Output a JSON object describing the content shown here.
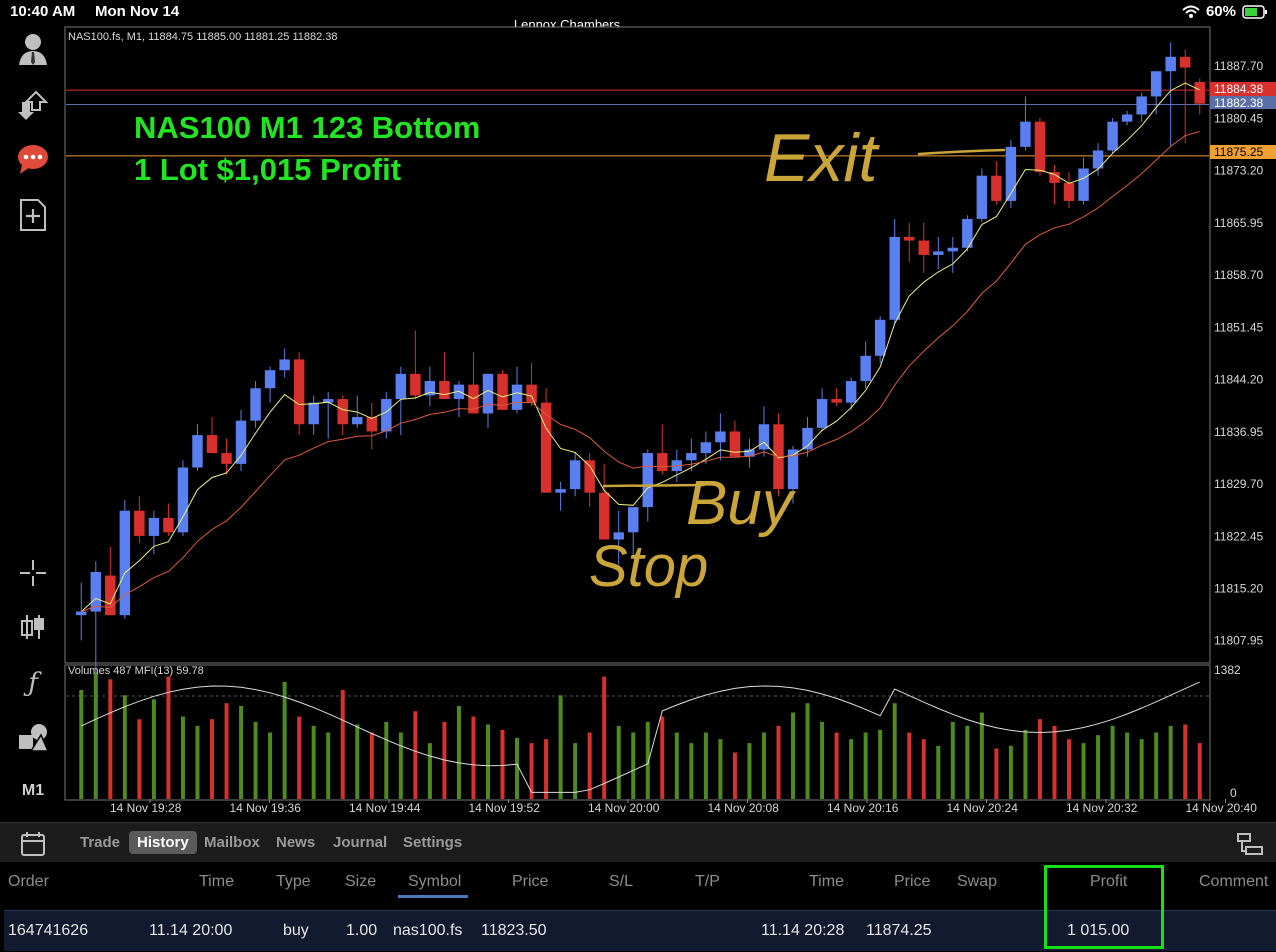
{
  "status": {
    "time": "10:40 AM",
    "date": "Mon Nov 14",
    "title": "Lennox Chambers",
    "battery": "60%"
  },
  "tools": {
    "account_icon": "person-icon",
    "timeframe": "M1"
  },
  "chart": {
    "header": "NAS100.fs, M1, 11884.75 11885.00 11881.25 11882.38",
    "annotation_line1": "NAS100 M1 123 Bottom",
    "annotation_line2": "1 Lot $1,015 Profit",
    "handwritten": {
      "exit": "Exit",
      "buy": "Buy",
      "stop": "Stop"
    },
    "price_labels": [
      "11887.70",
      "11880.45",
      "11873.20",
      "11865.95",
      "11858.70",
      "11851.45",
      "11844.20",
      "11836.95",
      "11829.70",
      "11822.45",
      "11815.20",
      "11807.95"
    ],
    "tag_red": "11884.38",
    "tag_blue": "11882.38",
    "tag_orange": "11875.25",
    "volume_header": "Volumes 487 MFI(13) 59.78",
    "volume_max": "1382",
    "volume_min": "0",
    "time_labels": [
      "14 Nov 19:28",
      "14 Nov 19:36",
      "14 Nov 19:44",
      "14 Nov 19:52",
      "14 Nov 20:00",
      "14 Nov 20:08",
      "14 Nov 20:16",
      "14 Nov 20:24",
      "14 Nov 20:32",
      "14 Nov 20:40"
    ],
    "colors": {
      "bull": "#5a7ff0",
      "bear": "#d8302c",
      "fast_ma": "#f0f080",
      "slow_ma": "#e05a3a",
      "vol_up": "#4e8a1e",
      "vol_down": "#d8302c",
      "annotation": "#22e422",
      "ink": "#c9a53a"
    }
  },
  "chart_data": {
    "type": "candlestick",
    "symbol": "NAS100.fs",
    "timeframe": "M1",
    "y_range": [
      11805,
      11893
    ],
    "x_range": [
      "14 Nov 19:24",
      "14 Nov 20:41"
    ],
    "candles_ohlc": [
      [
        11811.5,
        11816.0,
        11808.0,
        11812.0
      ],
      [
        11812.0,
        11819.0,
        11803.0,
        11817.5
      ],
      [
        11817.0,
        11821.0,
        11813.5,
        11811.5
      ],
      [
        11811.5,
        11827.5,
        11811.0,
        11826.0
      ],
      [
        11826.0,
        11828.0,
        11821.5,
        11822.5
      ],
      [
        11822.5,
        11826.0,
        11820.0,
        11825.0
      ],
      [
        11825.0,
        11827.0,
        11822.5,
        11823.0
      ],
      [
        11823.0,
        11833.0,
        11822.5,
        11832.0
      ],
      [
        11832.0,
        11838.0,
        11831.5,
        11836.5
      ],
      [
        11836.5,
        11839.0,
        11834.0,
        11834.0
      ],
      [
        11834.0,
        11836.0,
        11831.0,
        11832.5
      ],
      [
        11832.5,
        11840.0,
        11831.5,
        11838.5
      ],
      [
        11838.5,
        11844.0,
        11837.5,
        11843.0
      ],
      [
        11843.0,
        11846.0,
        11841.0,
        11845.5
      ],
      [
        11845.5,
        11848.5,
        11844.5,
        11847.0
      ],
      [
        11847.0,
        11848.0,
        11836.5,
        11838.0
      ],
      [
        11838.0,
        11842.0,
        11836.5,
        11841.0
      ],
      [
        11841.0,
        11842.5,
        11836.0,
        11841.5
      ],
      [
        11841.5,
        11842.0,
        11836.5,
        11838.0
      ],
      [
        11838.0,
        11842.0,
        11837.5,
        11839.0
      ],
      [
        11839.0,
        11841.0,
        11834.5,
        11837.0
      ],
      [
        11837.0,
        11842.5,
        11836.0,
        11841.5
      ],
      [
        11841.5,
        11846.0,
        11836.5,
        11845.0
      ],
      [
        11845.0,
        11851.0,
        11841.5,
        11842.0
      ],
      [
        11842.0,
        11846.0,
        11840.5,
        11844.0
      ],
      [
        11844.0,
        11848.0,
        11842.5,
        11841.5
      ],
      [
        11841.5,
        11844.0,
        11839.0,
        11843.5
      ],
      [
        11843.5,
        11848.0,
        11842.0,
        11839.5
      ],
      [
        11839.5,
        11844.0,
        11837.5,
        11845.0
      ],
      [
        11845.0,
        11845.5,
        11840.0,
        11840.0
      ],
      [
        11840.0,
        11846.0,
        11839.5,
        11843.5
      ],
      [
        11843.5,
        11846.5,
        11840.5,
        11841.0
      ],
      [
        11841.0,
        11843.0,
        11835.0,
        11828.5
      ],
      [
        11828.5,
        11830.0,
        11826.0,
        11829.0
      ],
      [
        11829.0,
        11834.0,
        11828.0,
        11833.0
      ],
      [
        11833.0,
        11834.0,
        11826.5,
        11828.5
      ],
      [
        11828.5,
        11832.5,
        11826.0,
        11822.0
      ],
      [
        11822.0,
        11826.0,
        11818.5,
        11823.0
      ],
      [
        11823.0,
        11826.5,
        11819.5,
        11826.5
      ],
      [
        11826.5,
        11834.5,
        11824.5,
        11834.0
      ],
      [
        11834.0,
        11838.0,
        11831.0,
        11831.5
      ],
      [
        11831.5,
        11834.5,
        11830.0,
        11833.0
      ],
      [
        11833.0,
        11836.0,
        11831.5,
        11834.0
      ],
      [
        11834.0,
        11837.0,
        11832.5,
        11835.5
      ],
      [
        11835.5,
        11839.5,
        11833.0,
        11837.0
      ],
      [
        11837.0,
        11838.5,
        11834.0,
        11833.5
      ],
      [
        11833.5,
        11836.0,
        11832.0,
        11834.5
      ],
      [
        11834.5,
        11840.5,
        11833.5,
        11838.0
      ],
      [
        11838.0,
        11839.5,
        11828.0,
        11829.0
      ],
      [
        11829.0,
        11835.0,
        11827.0,
        11834.5
      ],
      [
        11834.5,
        11839.0,
        11833.5,
        11837.5
      ],
      [
        11837.5,
        11843.0,
        11837.0,
        11841.5
      ],
      [
        11841.5,
        11843.0,
        11840.5,
        11841.0
      ],
      [
        11841.0,
        11844.5,
        11840.0,
        11844.0
      ],
      [
        11844.0,
        11849.5,
        11843.0,
        11847.5
      ],
      [
        11847.5,
        11853.0,
        11846.5,
        11852.5
      ],
      [
        11852.5,
        11866.5,
        11852.0,
        11864.0
      ],
      [
        11864.0,
        11866.0,
        11860.5,
        11863.5
      ],
      [
        11863.5,
        11866.0,
        11859.0,
        11861.5
      ],
      [
        11861.5,
        11864.0,
        11859.5,
        11862.0
      ],
      [
        11862.0,
        11864.0,
        11859.0,
        11862.5
      ],
      [
        11862.5,
        11867.0,
        11862.0,
        11866.5
      ],
      [
        11866.5,
        11873.5,
        11866.0,
        11872.5
      ],
      [
        11872.5,
        11874.5,
        11868.5,
        11869.0
      ],
      [
        11869.0,
        11877.5,
        11868.0,
        11876.5
      ],
      [
        11876.5,
        11883.5,
        11876.0,
        11880.0
      ],
      [
        11880.0,
        11880.5,
        11872.5,
        11873.0
      ],
      [
        11873.0,
        11874.0,
        11868.5,
        11871.5
      ],
      [
        11871.5,
        11873.0,
        11868.0,
        11869.0
      ],
      [
        11869.0,
        11875.0,
        11868.5,
        11873.5
      ],
      [
        11873.5,
        11877.0,
        11872.5,
        11876.0
      ],
      [
        11876.0,
        11880.5,
        11875.5,
        11880.0
      ],
      [
        11880.0,
        11881.5,
        11879.5,
        11881.0
      ],
      [
        11881.0,
        11884.0,
        11880.0,
        11883.5
      ],
      [
        11883.5,
        11887.0,
        11881.0,
        11887.0
      ],
      [
        11887.0,
        11891.0,
        11876.5,
        11889.0
      ],
      [
        11889.0,
        11890.0,
        11877.0,
        11887.5
      ],
      [
        11885.5,
        11886.0,
        11881.0,
        11882.5
      ]
    ],
    "volumes_relative": [
      0.82,
      0.95,
      0.9,
      0.78,
      0.6,
      0.75,
      0.92,
      0.62,
      0.55,
      0.6,
      0.72,
      0.7,
      0.58,
      0.5,
      0.88,
      0.62,
      0.55,
      0.5,
      0.82,
      0.56,
      0.5,
      0.58,
      0.5,
      0.66,
      0.42,
      0.58,
      0.7,
      0.62,
      0.56,
      0.52,
      0.46,
      0.42,
      0.45,
      0.78,
      0.42,
      0.5,
      0.92,
      0.55,
      0.5,
      0.58,
      0.62,
      0.5,
      0.42,
      0.5,
      0.45,
      0.35,
      0.42,
      0.5,
      0.55,
      0.65,
      0.72,
      0.58,
      0.5,
      0.45,
      0.5,
      0.52,
      0.72,
      0.5,
      0.45,
      0.4,
      0.58,
      0.55,
      0.65,
      0.38,
      0.4,
      0.52,
      0.6,
      0.55,
      0.45,
      0.42,
      0.48,
      0.55,
      0.5,
      0.45,
      0.5,
      0.55,
      0.56,
      0.42,
      0.5,
      0.45,
      0.38,
      0.3
    ],
    "series": [
      {
        "name": "NAS100.fs"
      }
    ]
  },
  "tabs": {
    "items": [
      {
        "label": "Trade",
        "active": false
      },
      {
        "label": "History",
        "active": true
      },
      {
        "label": "Mailbox",
        "active": false
      },
      {
        "label": "News",
        "active": false
      },
      {
        "label": "Journal",
        "active": false
      },
      {
        "label": "Settings",
        "active": false
      }
    ]
  },
  "history": {
    "columns": [
      "Order",
      "Time",
      "Type",
      "Size",
      "Symbol",
      "Price",
      "S/L",
      "T/P",
      "Time",
      "Price",
      "Swap",
      "Profit",
      "Comment"
    ],
    "row": {
      "order": "164741626",
      "open_time": "11.14 20:00",
      "type": "buy",
      "size": "1.00",
      "symbol": "nas100.fs",
      "open_price": "11823.50",
      "close_time": "11.14 20:28",
      "close_price": "11874.25",
      "profit": "1 015.00"
    }
  }
}
